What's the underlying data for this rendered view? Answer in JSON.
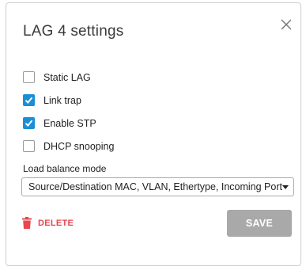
{
  "dialog": {
    "title": "LAG 4 settings"
  },
  "options": [
    {
      "label": "Static LAG",
      "checked": false
    },
    {
      "label": "Link trap",
      "checked": true
    },
    {
      "label": "Enable STP",
      "checked": true
    },
    {
      "label": "DHCP snooping",
      "checked": false
    }
  ],
  "load_balance": {
    "label": "Load balance mode",
    "selected": "Source/Destination MAC, VLAN, Ethertype, Incoming Port"
  },
  "actions": {
    "delete_label": "DELETE",
    "save_label": "SAVE"
  },
  "icons": {
    "close": "close-icon",
    "check": "checkmark-icon",
    "dropdown": "caret-down-icon",
    "delete": "trash-icon"
  },
  "colors": {
    "accent": "#1a8fd6",
    "danger": "#e8474f",
    "save_disabled": "#a9a9a9"
  }
}
